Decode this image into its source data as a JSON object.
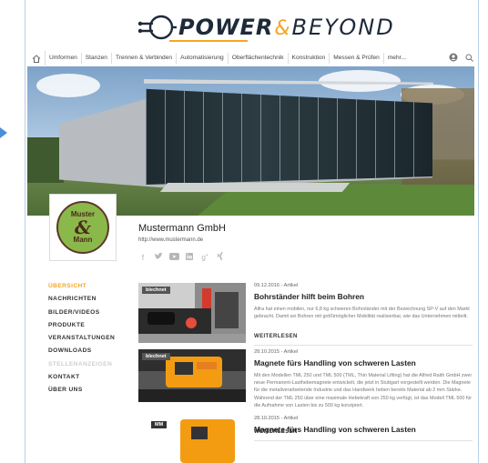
{
  "logo": {
    "power": "POWER",
    "amp": "&",
    "beyond": "BEYOND"
  },
  "nav": {
    "items": [
      "Umformen",
      "Stanzen",
      "Trennen & Verbinden",
      "Automatisierung",
      "Oberflächentechnik",
      "Konstruktion",
      "Messen & Prüfen",
      "mehr..."
    ]
  },
  "company": {
    "name": "Mustermann GmbH",
    "url": "http://www.mustermann.de",
    "logo_top": "Muster",
    "logo_amp": "&",
    "logo_bottom": "Mann"
  },
  "sidebar": {
    "items": [
      {
        "label": "ÜBERSICHT",
        "state": "active"
      },
      {
        "label": "NACHRICHTEN",
        "state": "normal"
      },
      {
        "label": "BILDER/VIDEOS",
        "state": "normal"
      },
      {
        "label": "PRODUKTE",
        "state": "normal"
      },
      {
        "label": "VERANSTALTUNGEN",
        "state": "normal"
      },
      {
        "label": "DOWNLOADS",
        "state": "normal"
      },
      {
        "label": "STELLENANZEIGEN",
        "state": "disabled"
      },
      {
        "label": "KONTAKT",
        "state": "normal"
      },
      {
        "label": "ÜBER UNS",
        "state": "normal"
      }
    ]
  },
  "articles": [
    {
      "tag": "blechnet",
      "meta": "09.12.2016 - Artikel",
      "title": "Bohrständer hilft beim Bohren",
      "text": "Alfra hat einen mobilen, nur 6,8 kg schweren Bohrständer mit der Bezeichnung SP-V auf den Markt gebracht. Damit sei Bohren mit größtmöglicher Mobilität realisierbar, wie das Unternehmen mitteilt.",
      "more": "WEITERLESEN"
    },
    {
      "tag": "blechnet",
      "meta": "28.10.2015 - Artikel",
      "title": "Magnete fürs Handling von schweren Lasten",
      "text": "Mit den Modellen TML 250 und TML 500 (TML, Thin Material Lifting) hat die Alfred Raith GmbH zwei neue Permanent-Lasthebemagnete entwickelt, die jetzt in Stuttgart vorgestellt werden. Die Magnete für die metallverarbeitende Industrie und das Handwerk heben bereits Material ab 2 mm Stärke. Während der TML 250 über eine maximale Hebekraft von 250 kg verfügt, ist das Modell TML 500 für die Aufnahme von Lasten bis zu 500 kg konzipiert.",
      "more": "WEITERLESEN"
    },
    {
      "tag": "MM",
      "meta": "28.10.2015 - Artikel",
      "title": "Magnete fürs Handling von schweren Lasten"
    }
  ]
}
